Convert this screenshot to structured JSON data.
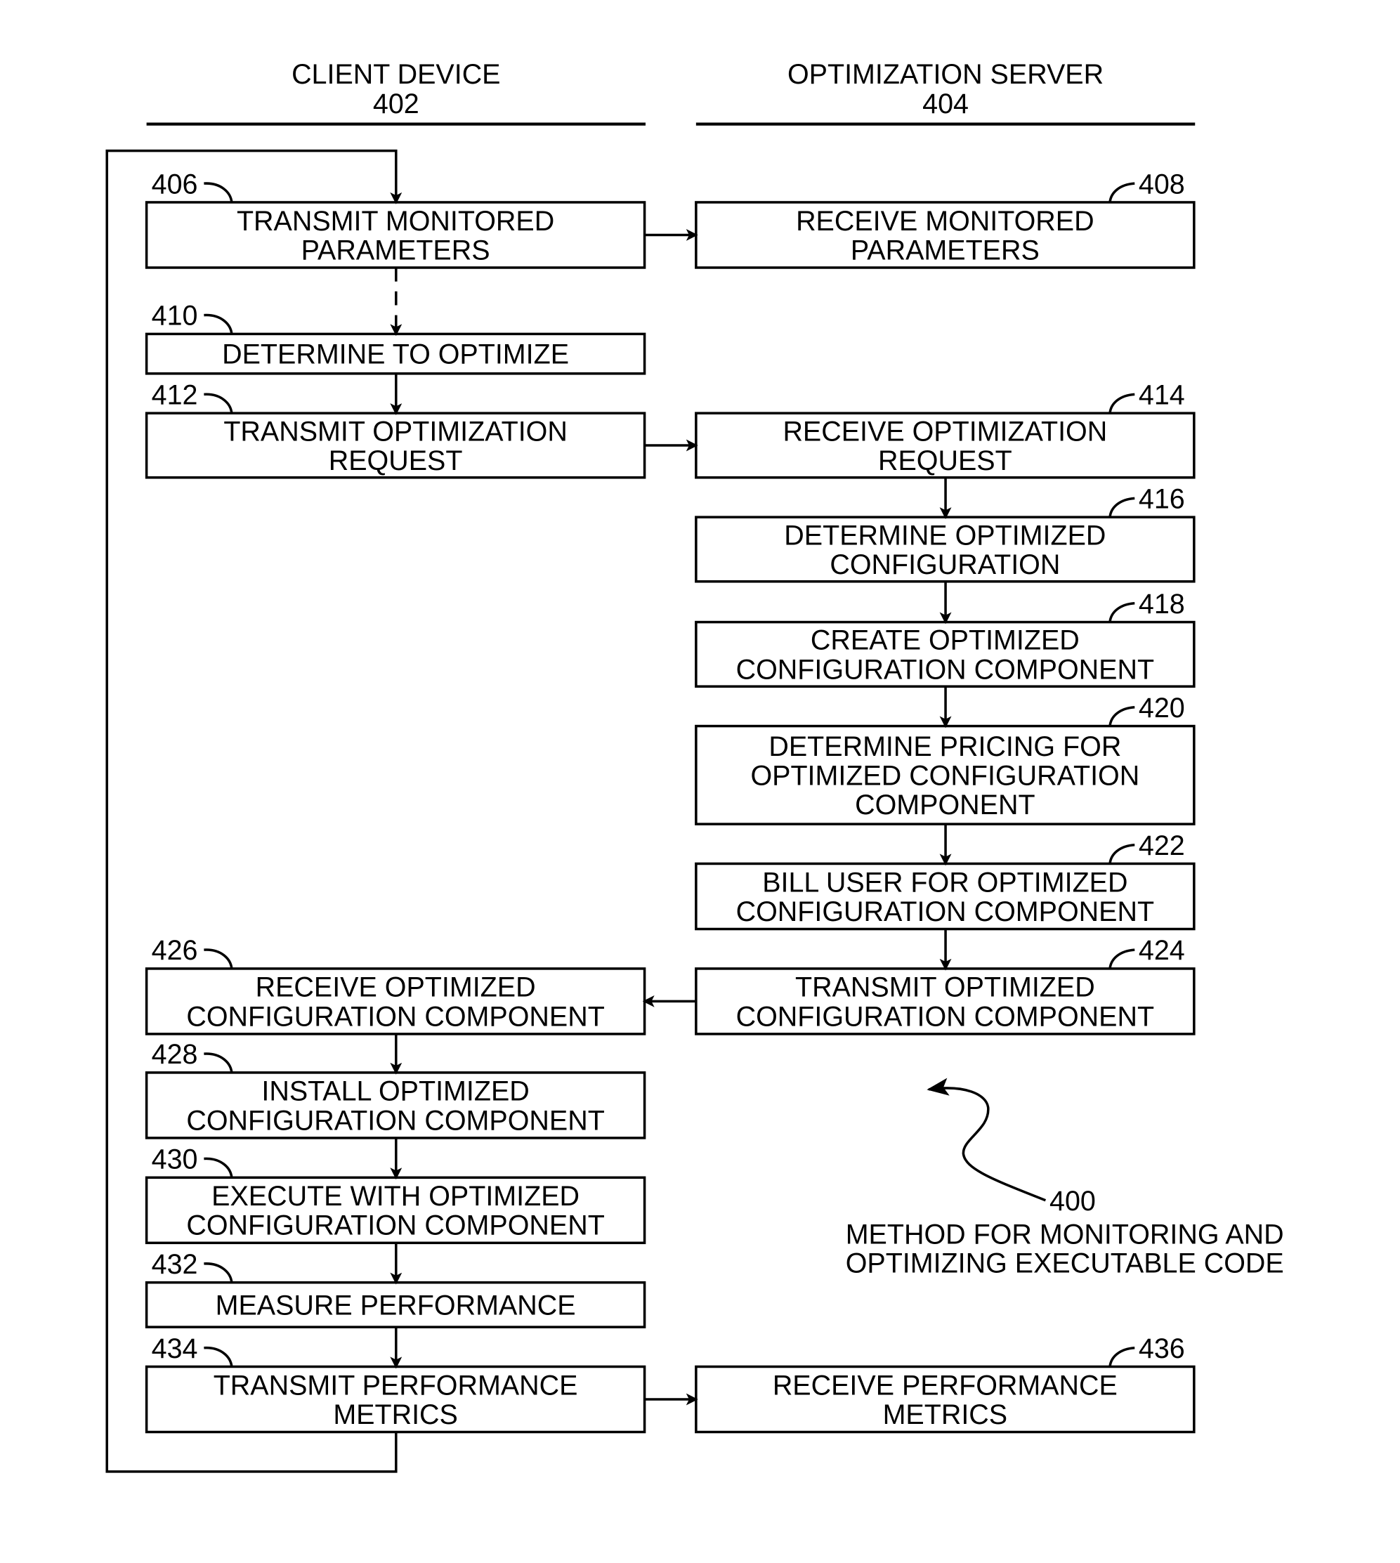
{
  "lanes": [
    {
      "title": "CLIENT DEVICE",
      "ref": "402"
    },
    {
      "title": "OPTIMIZATION SERVER",
      "ref": "404"
    }
  ],
  "steps": [
    {
      "id": "406",
      "lane": 0,
      "lines": [
        "TRANSMIT MONITORED",
        "PARAMETERS"
      ]
    },
    {
      "id": "408",
      "lane": 1,
      "lines": [
        "RECEIVE MONITORED",
        "PARAMETERS"
      ]
    },
    {
      "id": "410",
      "lane": 0,
      "lines": [
        "DETERMINE TO OPTIMIZE"
      ]
    },
    {
      "id": "412",
      "lane": 0,
      "lines": [
        "TRANSMIT OPTIMIZATION",
        "REQUEST"
      ]
    },
    {
      "id": "414",
      "lane": 1,
      "lines": [
        "RECEIVE OPTIMIZATION",
        "REQUEST"
      ]
    },
    {
      "id": "416",
      "lane": 1,
      "lines": [
        "DETERMINE OPTIMIZED",
        "CONFIGURATION"
      ]
    },
    {
      "id": "418",
      "lane": 1,
      "lines": [
        "CREATE OPTIMIZED",
        "CONFIGURATION COMPONENT"
      ]
    },
    {
      "id": "420",
      "lane": 1,
      "lines": [
        "DETERMINE PRICING FOR",
        "OPTIMIZED CONFIGURATION",
        "COMPONENT"
      ]
    },
    {
      "id": "422",
      "lane": 1,
      "lines": [
        "BILL USER FOR OPTIMIZED",
        "CONFIGURATION COMPONENT"
      ]
    },
    {
      "id": "424",
      "lane": 1,
      "lines": [
        "TRANSMIT OPTIMIZED",
        "CONFIGURATION COMPONENT"
      ]
    },
    {
      "id": "426",
      "lane": 0,
      "lines": [
        "RECEIVE OPTIMIZED",
        "CONFIGURATION COMPONENT"
      ]
    },
    {
      "id": "428",
      "lane": 0,
      "lines": [
        "INSTALL OPTIMIZED",
        "CONFIGURATION COMPONENT"
      ]
    },
    {
      "id": "430",
      "lane": 0,
      "lines": [
        "EXECUTE WITH OPTIMIZED",
        "CONFIGURATION COMPONENT"
      ]
    },
    {
      "id": "432",
      "lane": 0,
      "lines": [
        "MEASURE PERFORMANCE"
      ]
    },
    {
      "id": "434",
      "lane": 0,
      "lines": [
        "TRANSMIT PERFORMANCE",
        "METRICS"
      ]
    },
    {
      "id": "436",
      "lane": 1,
      "lines": [
        "RECEIVE PERFORMANCE",
        "METRICS"
      ]
    }
  ],
  "figure": {
    "ref": "400",
    "caption": [
      "METHOD FOR MONITORING AND",
      "OPTIMIZING EXECUTABLE CODE"
    ]
  }
}
